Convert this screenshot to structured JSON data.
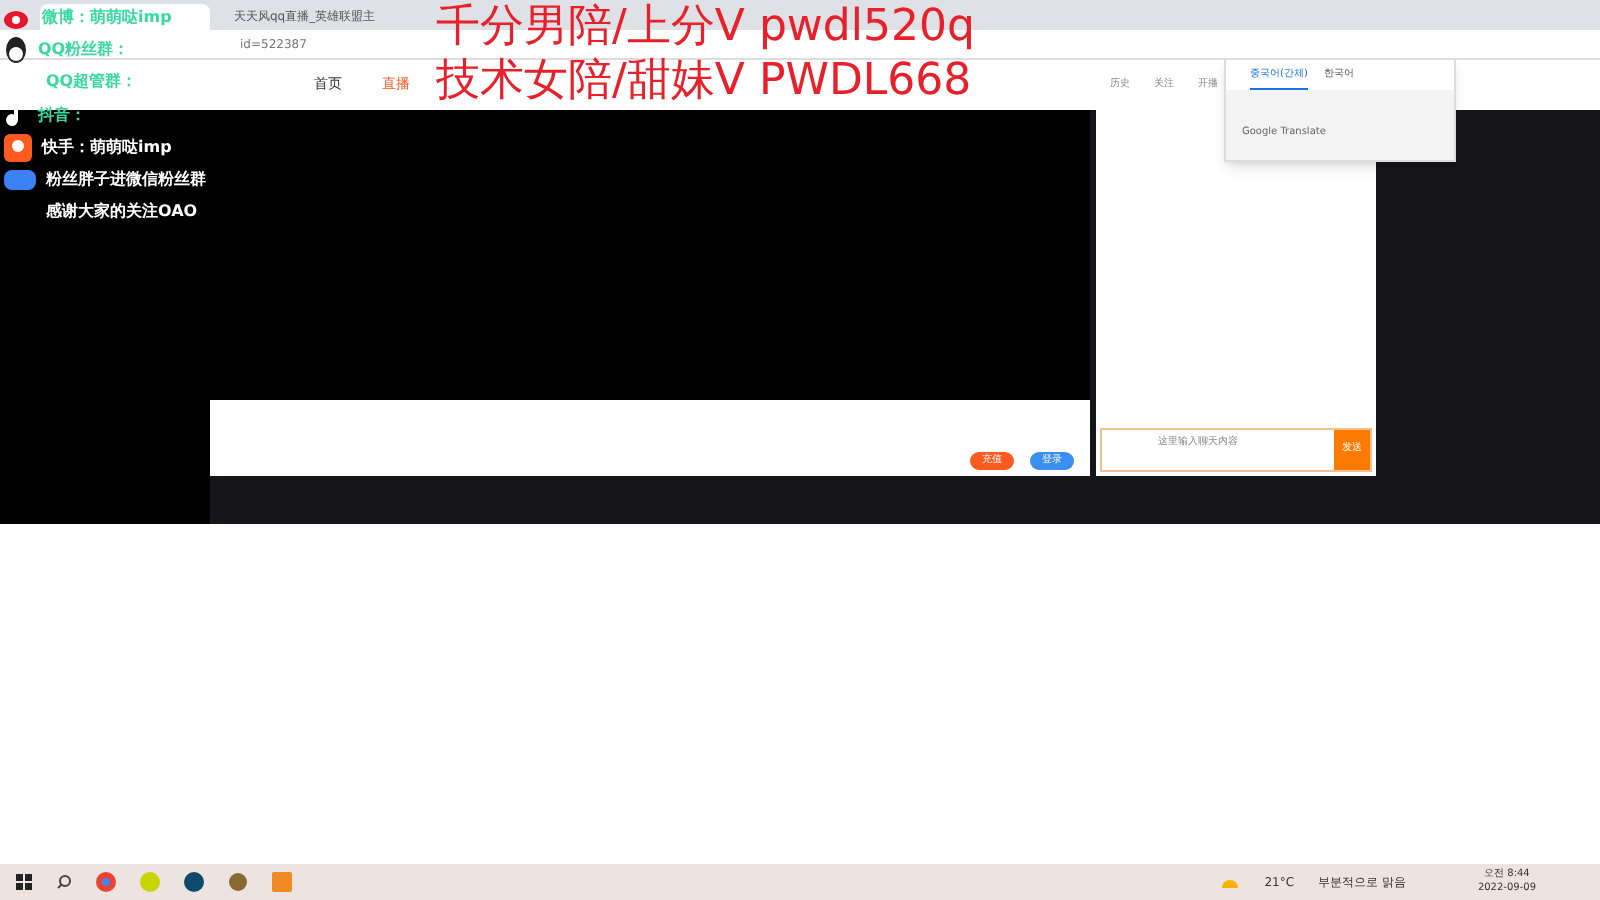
{
  "browser": {
    "tabs": [
      {
        "selected": true
      },
      {
        "title": "天天风qq直播_英雄联盟主",
        "selected": false
      }
    ],
    "url": "id=522387"
  },
  "site": {
    "nav": [
      {
        "label": "首页",
        "selected": false
      },
      {
        "label": "直播",
        "selected": true
      }
    ],
    "side_icons": [
      "历史",
      "关注",
      "开播"
    ]
  },
  "translate_popup": {
    "tabs": [
      {
        "label": "중국어(간체)",
        "selected": true
      },
      {
        "label": "한국어",
        "selected": false
      }
    ],
    "footer": "Google Translate"
  },
  "player": {
    "buttons": [
      {
        "label": "充值",
        "kind": "orange"
      },
      {
        "label": "登录",
        "kind": "blue"
      }
    ]
  },
  "chat": {
    "placeholder": "这里输入聊天内容",
    "send": "发送"
  },
  "overlay": {
    "promo": [
      "千分男陪/上分V pwdl520q",
      "技术女陪/甜妹V PWDL668"
    ],
    "lines": [
      {
        "text": "微博：萌萌哒imp",
        "kind": "weibo"
      },
      {
        "text": "QQ粉丝群：",
        "kind": "qq"
      },
      {
        "text": "QQ超管群：",
        "kind": "none"
      },
      {
        "text": "抖音：",
        "kind": "tiktok"
      },
      {
        "text": "快手：萌萌哒imp",
        "kind": "kuaishou"
      },
      {
        "text": "粉丝胖子进微信粉丝群",
        "kind": "badge"
      },
      {
        "text": "感谢大家的关注OAO",
        "kind": "none"
      }
    ]
  },
  "taskbar": {
    "weather": "21°C",
    "weather_text": "부분적으로 맑음",
    "time": "오전 8:44",
    "date": "2022-09-09"
  }
}
